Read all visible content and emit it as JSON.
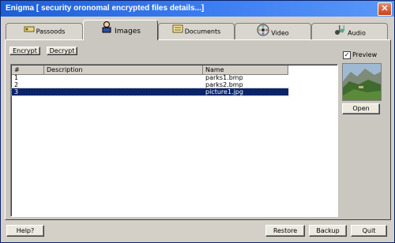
{
  "window": {
    "title": "Enigma [ security oronomal encrypted files details...]"
  },
  "tabs": [
    {
      "label": "Passoods",
      "icon": "key-icon"
    },
    {
      "label": "Images",
      "icon": "person-icon",
      "active": true
    },
    {
      "label": "Documents",
      "icon": "document-icon"
    },
    {
      "label": "Video",
      "icon": "film-reel-icon"
    },
    {
      "label": "Audio",
      "icon": "music-notes-icon"
    }
  ],
  "toolbar": {
    "encrypt_label": "Encrypt",
    "decrypt_label": "Decrypt"
  },
  "table": {
    "headers": {
      "num": "#",
      "description": "Description",
      "name": "Name"
    },
    "rows": [
      {
        "num": "1",
        "description": "",
        "name": "parks1.bmp"
      },
      {
        "num": "2",
        "description": "",
        "name": "parks2.bmp"
      },
      {
        "num": "3",
        "description": "",
        "name": "picture1.jpg"
      }
    ],
    "selected_row": 2
  },
  "preview": {
    "label": "Preview",
    "checked": true,
    "open_label": "Open"
  },
  "footer": {
    "help_label": "Help?",
    "restore_label": "Restore",
    "backup_label": "Backup",
    "quit_label": "Quit"
  },
  "colors": {
    "titlebar": "#2a6ee6",
    "selection": "#0a246a",
    "face": "#d4d0c8"
  }
}
